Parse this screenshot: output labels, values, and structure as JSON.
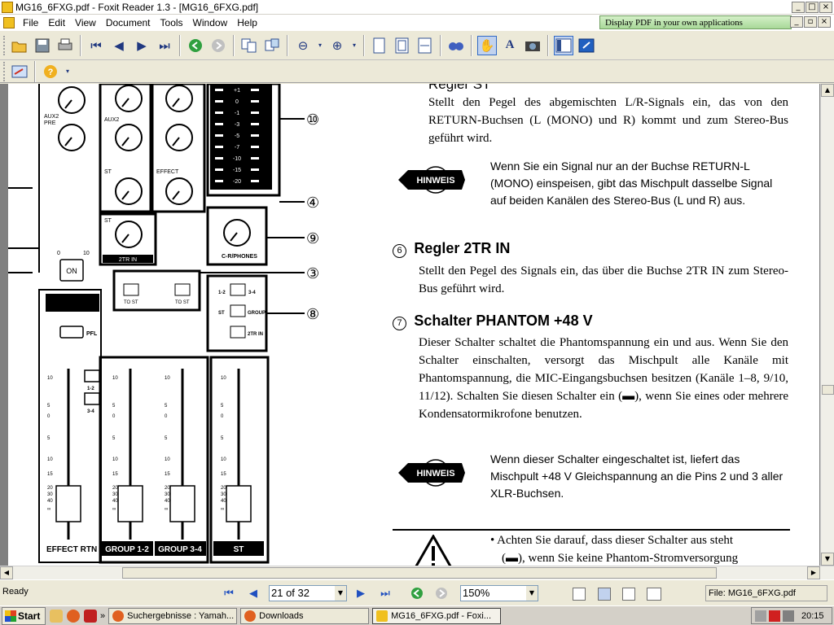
{
  "window": {
    "title": "MG16_6FXG.pdf - Foxit Reader 1.3 - [MG16_6FXG.pdf]",
    "min": "_",
    "max": "□",
    "close": "×",
    "doc_min": "_",
    "doc_restore": "▫",
    "doc_close": "×"
  },
  "menu": {
    "items": [
      "File",
      "Edit",
      "View",
      "Document",
      "Tools",
      "Window",
      "Help"
    ],
    "ad": "Display PDF in your own applications"
  },
  "pdf": {
    "regler_st_partial": "Regler ST",
    "para1": "Stellt den Pegel des abgemischten L/R-Signals ein, das von den RETURN-Buchsen (L (MONO) und R) kommt und zum Stereo-Bus geführt wird.",
    "hinweis_label": "HINWEIS",
    "note1": "Wenn Sie ein Signal nur an der Buchse RETURN-L (MONO) einspeisen, gibt das Mischpult dasselbe Signal auf beiden Kanälen des Stereo-Bus (L und R) aus.",
    "h6_num": "6",
    "h6_title": "Regler 2TR IN",
    "para6": "Stellt den Pegel des Signals ein, das über die Buchse 2TR IN zum Stereo-Bus geführt wird.",
    "h7_num": "7",
    "h7_title": "Schalter PHANTOM +48 V",
    "para7": "Dieser Schalter schaltet die Phantomspannung ein und aus. Wenn Sie den Schalter einschalten, versorgt das Mischpult alle Kanäle mit Phantomspannung, die MIC-Eingangsbuchsen besitzen (Kanäle 1–8, 9/10, 11/12). Schalten Sie diesen Schalter ein (▬), wenn Sie eines oder mehrere Kondensatormikrofone benutzen.",
    "note2": "Wenn dieser Schalter eingeschaltet ist, liefert das Mischpult +48 V Gleichspannung an die Pins 2 und 3 aller XLR-Buchsen.",
    "warning_line1": "• Achten Sie darauf, dass dieser Schalter aus steht",
    "warning_line2": "(▬), wenn Sie keine Phantom-Stromversorgung",
    "callouts": [
      "⑩",
      "④",
      "⑨",
      "③",
      "⑧"
    ],
    "diagram": {
      "aux2pre": "AUX2\nPRE",
      "aux2": "AUX2",
      "st": "ST",
      "effect": "EFFECT",
      "st2": "ST",
      "twotr_in": "2TR IN",
      "cr_phones": "C-R/PHONES",
      "on": "ON",
      "pfl": "PFL",
      "to_st1": "TO ST",
      "to_st2": "TO ST",
      "sw12": "1-2",
      "sw34": "3-4",
      "sw_st": "ST",
      "sw_group": "GROUP",
      "sw_2trin": "2TR IN",
      "assign_12": "1-2",
      "assign_34": "3-4",
      "effect_rtn": "EFFECT RTN",
      "group12": "GROUP 1-2",
      "group34": "GROUP 3-4",
      "st_label": "ST",
      "meter_labels": [
        "+1",
        "0",
        "-1",
        "-3",
        "-5",
        "-7",
        "-10",
        "-15",
        "-20"
      ],
      "fader_scale": [
        "10",
        "5",
        "0",
        "5",
        "10",
        "15",
        "20",
        "30",
        "40",
        "∞"
      ],
      "knob_min": "0",
      "knob_max": "10"
    }
  },
  "status": {
    "ready": "Ready",
    "page": "21 of 32",
    "zoom": "150%",
    "file": "File: MG16_6FXG.pdf"
  },
  "taskbar": {
    "start": "Start",
    "chevron": "»",
    "tasks": [
      "Suchergebnisse : Yamah...",
      "Downloads",
      "MG16_6FXG.pdf - Foxi..."
    ],
    "clock": "20:15"
  }
}
